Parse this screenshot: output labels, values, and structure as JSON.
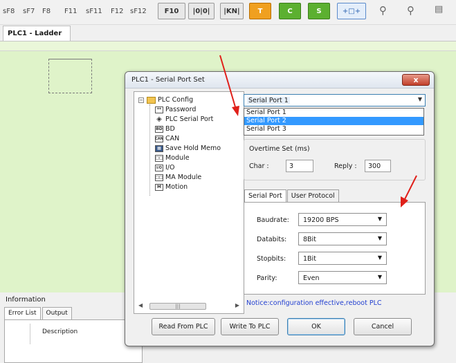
{
  "toolbar": {
    "fkeys": [
      "sF8",
      "sF7",
      "F8",
      "F11",
      "sF11",
      "F12",
      "sF12"
    ],
    "buttons": [
      "F10",
      "|0|0|",
      "|KN|",
      "T",
      "C",
      "S",
      "+□+"
    ],
    "icons": [
      "zoom-in-icon",
      "zoom-out-icon"
    ]
  },
  "tab": {
    "label": "PLC1 - Ladder"
  },
  "info": {
    "title": "Information",
    "tabs": [
      "Error List",
      "Output"
    ],
    "column": "Description"
  },
  "dialog": {
    "title": "PLC1 - Serial Port  Set",
    "close_label": "x",
    "tree": {
      "root": "PLC Config",
      "items": [
        {
          "label": "Password",
          "icon": "password-icon",
          "glyph": "**"
        },
        {
          "label": "PLC Serial Port",
          "icon": "serial-port-icon",
          "glyph": "◈"
        },
        {
          "label": "BD",
          "icon": "bd-icon",
          "glyph": "BD"
        },
        {
          "label": "CAN",
          "icon": "can-icon",
          "glyph": "CAN"
        },
        {
          "label": "Save Hold Memo",
          "icon": "save-hold-memo-icon",
          "glyph": "▦"
        },
        {
          "label": "Module",
          "icon": "module-icon",
          "glyph": "□□"
        },
        {
          "label": "I/O",
          "icon": "io-icon",
          "glyph": "I/O"
        },
        {
          "label": "MA Module",
          "icon": "ma-module-icon",
          "glyph": "□□"
        },
        {
          "label": "Motion",
          "icon": "motion-icon",
          "glyph": "M"
        }
      ]
    },
    "port": {
      "selected": "Serial Port 1",
      "options": [
        "Serial Port 1",
        "Serial Port 2",
        "Serial Port 3"
      ],
      "highlighted": "Serial Port 2"
    },
    "overtime": {
      "label": "Overtime Set (ms)",
      "char_label": "Char :",
      "char_value": "3",
      "reply_label": "Reply :",
      "reply_value": "300"
    },
    "tabs": [
      "Serial Port",
      "User Protocol"
    ],
    "settings": {
      "baudrate_label": "Baudrate:",
      "baudrate": "19200 BPS",
      "databits_label": "Databits:",
      "databits": "8Bit",
      "stopbits_label": "Stopbits:",
      "stopbits": "1Bit",
      "parity_label": "Parity:",
      "parity": "Even"
    },
    "notice": "Notice:configuration effective,reboot PLC",
    "buttons": {
      "read": "Read From PLC",
      "write": "Write To PLC",
      "ok": "OK",
      "cancel": "Cancel"
    }
  },
  "colors": {
    "annotation_arrow": "#e0201a",
    "ladder_bg": "#dff3c9",
    "selection": "#3399ff"
  }
}
